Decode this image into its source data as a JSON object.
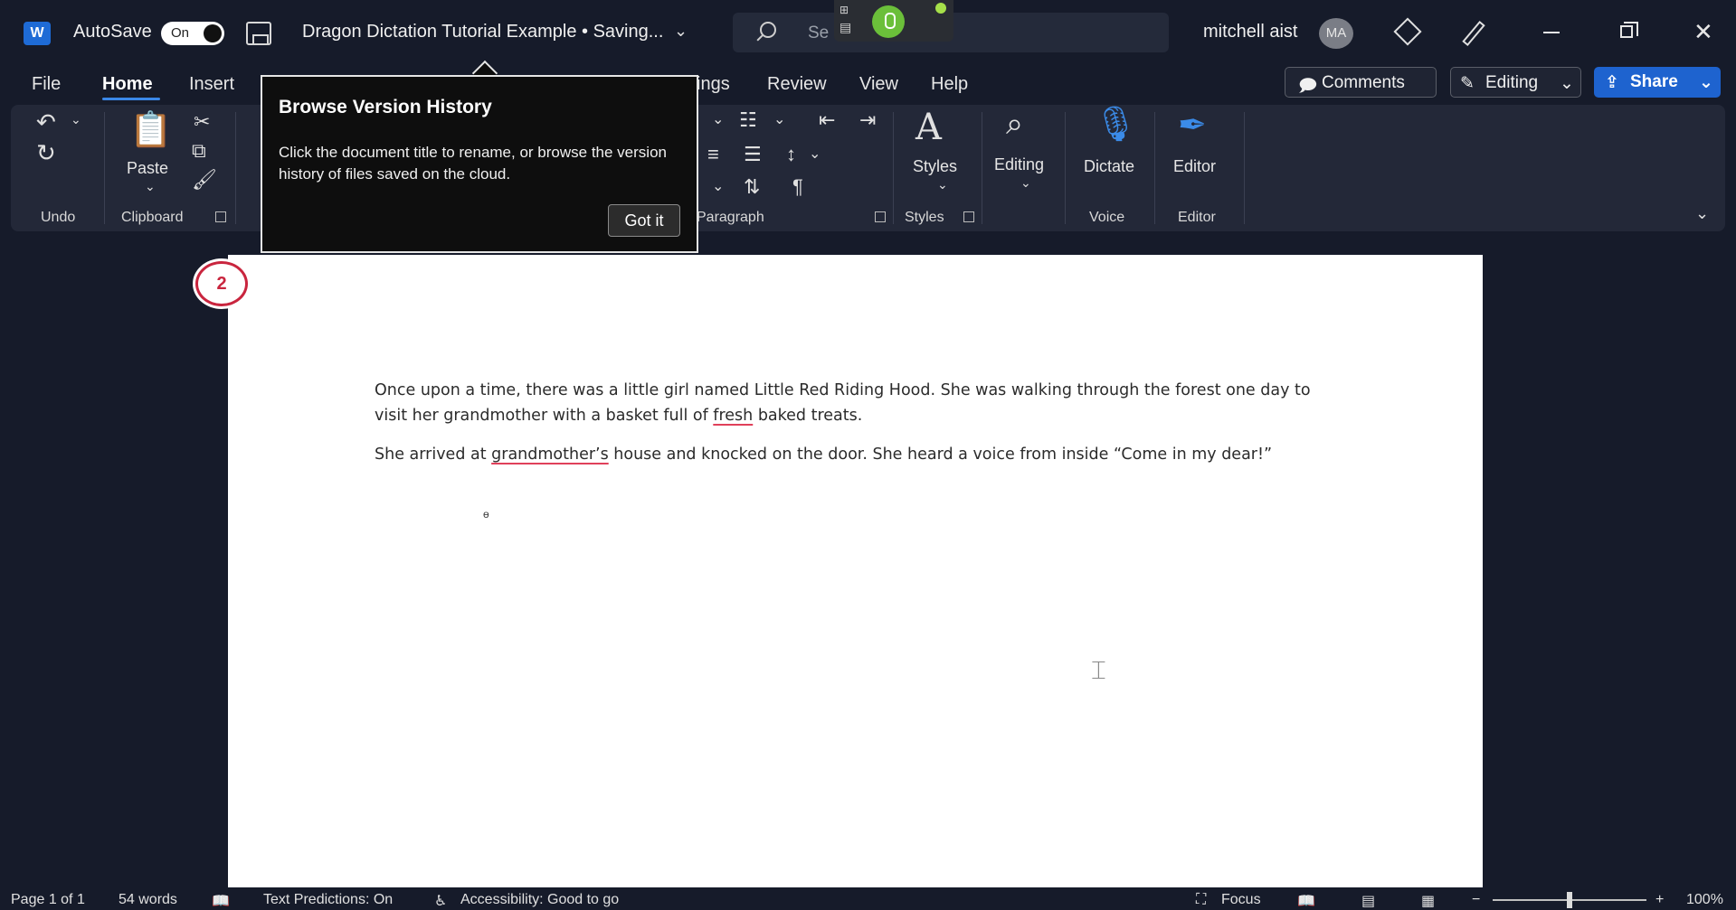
{
  "titlebar": {
    "autosave_label": "AutoSave",
    "autosave_state": "On",
    "doc_title": "Dragon Dictation Tutorial Example • Saving...",
    "search_placeholder": "Se",
    "user_name": "mitchell aist",
    "avatar_initials": "MA"
  },
  "menu": {
    "tabs": [
      "File",
      "Home",
      "Insert",
      "ings",
      "Review",
      "View",
      "Help"
    ],
    "active_tab": "Home",
    "comments_label": "Comments",
    "editing_label": "Editing",
    "share_label": "Share"
  },
  "ribbon": {
    "groups": {
      "undo": "Undo",
      "clipboard": "Clipboard",
      "paragraph": "Paragraph",
      "styles": "Styles",
      "voice": "Voice",
      "editor": "Editor"
    },
    "buttons": {
      "paste": "Paste",
      "styles": "Styles",
      "editing": "Editing",
      "dictate": "Dictate",
      "editor": "Editor"
    }
  },
  "tooltip": {
    "title": "Browse Version History",
    "body": "Click the document title to rename, or browse the version history of files saved on the cloud.",
    "button": "Got it"
  },
  "document": {
    "para1_before": "Once upon a time, there was a little girl named Little Red Riding Hood. She was walking through the forest one day to visit her grandmother with a basket full of ",
    "para1_misspelled": "fresh",
    "para1_after": " baked treats.",
    "para2_before": "She arrived at ",
    "para2_misspelled": "grandmother’s",
    "para2_after": " house and knocked on the door. She heard a voice from inside “Come in my dear!”",
    "badge": "2"
  },
  "status": {
    "page": "Page 1 of 1",
    "words": "54 words",
    "predictions": "Text Predictions: On",
    "accessibility": "Accessibility: Good to go",
    "focus": "Focus",
    "zoom": "100%",
    "zoom_level_percent": 100
  },
  "colors": {
    "background": "#161b2a",
    "accent": "#1e63cf",
    "dragon_green": "#6bbf3a",
    "badge_red": "#c9253e"
  }
}
